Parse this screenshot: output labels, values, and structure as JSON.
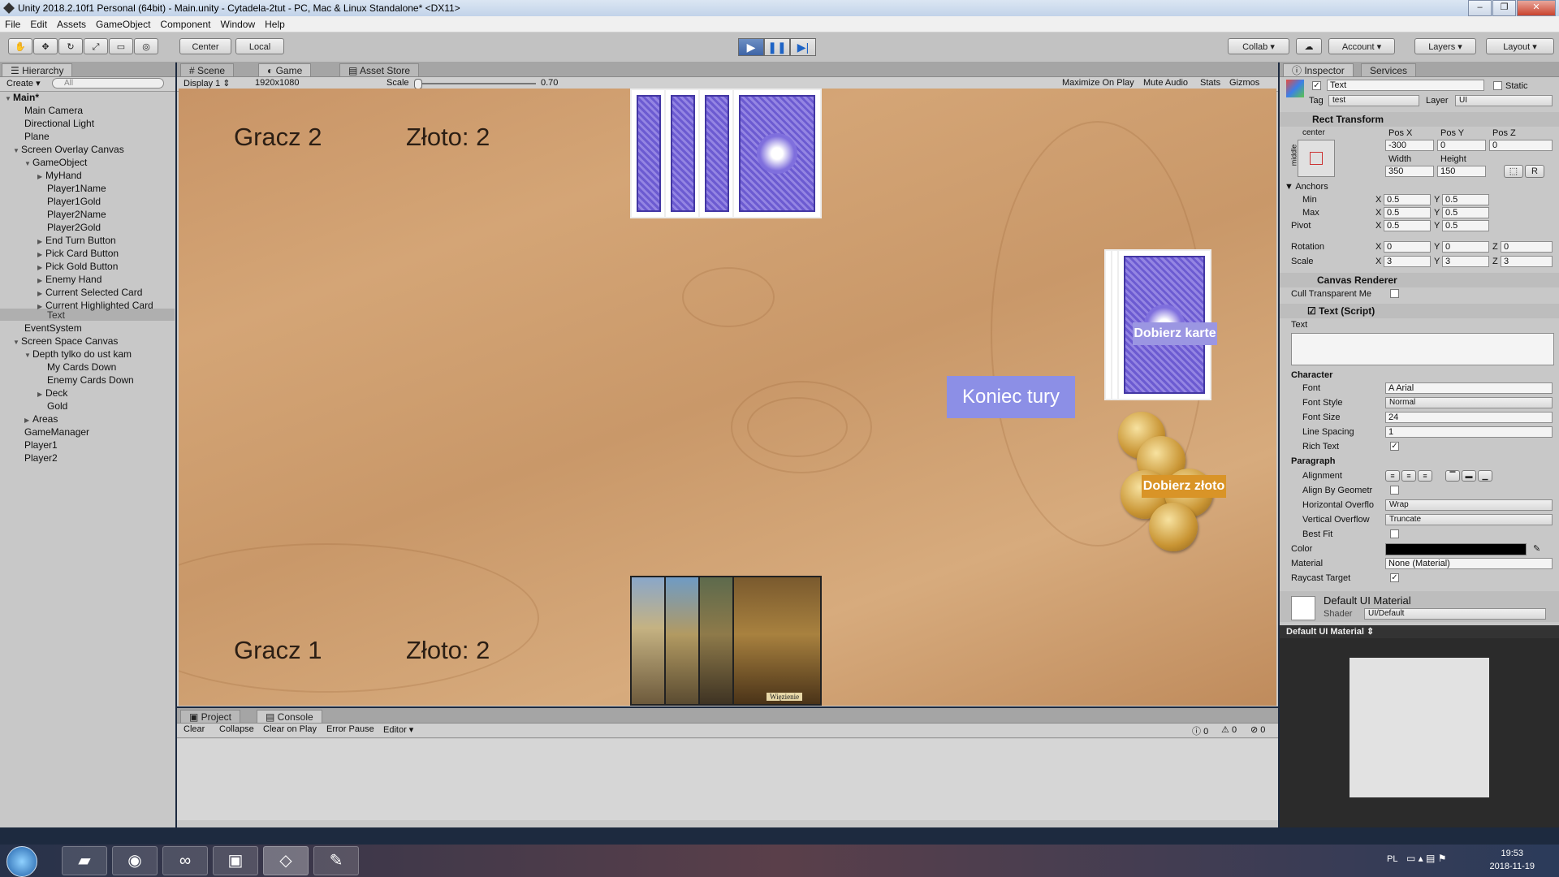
{
  "window": {
    "title": "Unity 2018.2.10f1 Personal (64bit) - Main.unity - Cytadela-2tut - PC, Mac & Linux Standalone* <DX11>"
  },
  "menu": [
    "File",
    "Edit",
    "Assets",
    "GameObject",
    "Component",
    "Window",
    "Help"
  ],
  "toolbar": {
    "center": "Center",
    "local": "Local",
    "collab": "Collab",
    "account": "Account",
    "layers": "Layers",
    "layout": "Layout"
  },
  "hierarchy": {
    "tab": "Hierarchy",
    "create": "Create",
    "search_placeholder": "All",
    "items": [
      "Main*",
      "Main Camera",
      "Directional Light",
      "Plane",
      "Screen Overlay Canvas",
      "GameObject",
      "MyHand",
      "Player1Name",
      "Player1Gold",
      "Player2Name",
      "Player2Gold",
      "End Turn Button",
      "Pick Card Button",
      "Pick Gold Button",
      "Enemy Hand",
      "Current Selected Card",
      "Current Highlighted Card",
      "Text",
      "EventSystem",
      "Screen Space Canvas",
      "Depth tylko do ust kam",
      "My Cards Down",
      "Enemy Cards Down",
      "Deck",
      "Gold",
      "Areas",
      "GameManager",
      "Player1",
      "Player2"
    ]
  },
  "view": {
    "tabs": [
      "Scene",
      "Game",
      "Asset Store"
    ],
    "display": "Display 1",
    "resolution": "1920x1080",
    "scale_label": "Scale",
    "scale_value": "0.70",
    "maximize": "Maximize On Play",
    "mute": "Mute Audio",
    "stats": "Stats",
    "gizmos": "Gizmos"
  },
  "game": {
    "p2_name": "Gracz 2",
    "p2_gold": "Złoto: 2",
    "p1_name": "Gracz 1",
    "p1_gold": "Złoto: 2",
    "end_turn": "Koniec tury",
    "pick_card": "Dobierz karte",
    "pick_gold": "Dobierz złoto",
    "card_caption": "Więzienie"
  },
  "console": {
    "tabs": [
      "Project",
      "Console"
    ],
    "buttons": [
      "Clear",
      "Collapse",
      "Clear on Play",
      "Error Pause",
      "Editor"
    ],
    "counts": [
      "0",
      "0",
      "0"
    ]
  },
  "inspector": {
    "tabs": [
      "Inspector",
      "Services"
    ],
    "object_name": "Text",
    "static": "Static",
    "tag_label": "Tag",
    "tag_value": "test",
    "layer_label": "Layer",
    "layer_value": "UI",
    "rect": {
      "title": "Rect Transform",
      "anchor_h": "center",
      "anchor_v": "middle",
      "pos_x_label": "Pos X",
      "pos_y_label": "Pos Y",
      "pos_z_label": "Pos Z",
      "pos_x": "-300",
      "pos_y": "0",
      "pos_z": "0",
      "width_label": "Width",
      "height_label": "Height",
      "width": "350",
      "height": "150",
      "anchors": "Anchors",
      "min": "Min",
      "max": "Max",
      "pivot": "Pivot",
      "rotation": "Rotation",
      "scale": "Scale",
      "min_x": "0.5",
      "min_y": "0.5",
      "max_x": "0.5",
      "max_y": "0.5",
      "pivot_x": "0.5",
      "pivot_y": "0.5",
      "rot_x": "0",
      "rot_y": "0",
      "rot_z": "0",
      "scale_x": "3",
      "scale_y": "3",
      "scale_z": "3",
      "x": "X",
      "y": "Y",
      "z": "Z"
    },
    "canvas_renderer": {
      "title": "Canvas Renderer",
      "cull": "Cull Transparent Me"
    },
    "text": {
      "title": "Text (Script)",
      "text_label": "Text",
      "character": "Character",
      "font_label": "Font",
      "font_value": "Arial",
      "font_style_label": "Font Style",
      "font_style_value": "Normal",
      "font_size_label": "Font Size",
      "font_size_value": "24",
      "line_spacing_label": "Line Spacing",
      "line_spacing_value": "1",
      "rich_text_label": "Rich Text",
      "paragraph": "Paragraph",
      "alignment_label": "Alignment",
      "align_geom_label": "Align By Geometr",
      "h_overflow_label": "Horizontal Overflo",
      "h_overflow_value": "Wrap",
      "v_overflow_label": "Vertical Overflow",
      "v_overflow_value": "Truncate",
      "best_fit_label": "Best Fit",
      "color_label": "Color",
      "material_label": "Material",
      "material_value": "None (Material)",
      "raycast_label": "Raycast Target"
    },
    "material": {
      "title": "Default UI Material",
      "shader_label": "Shader",
      "shader_value": "UI/Default",
      "preview_title": "Default UI Material"
    }
  },
  "taskbar": {
    "lang": "PL",
    "time": "19:53",
    "date": "2018-11-19"
  },
  "colors": {
    "play_active": "#3e64a6",
    "end_turn": "#8c8fe6",
    "pick_card": "#9b96e2",
    "pick_gold": "#d99427"
  }
}
